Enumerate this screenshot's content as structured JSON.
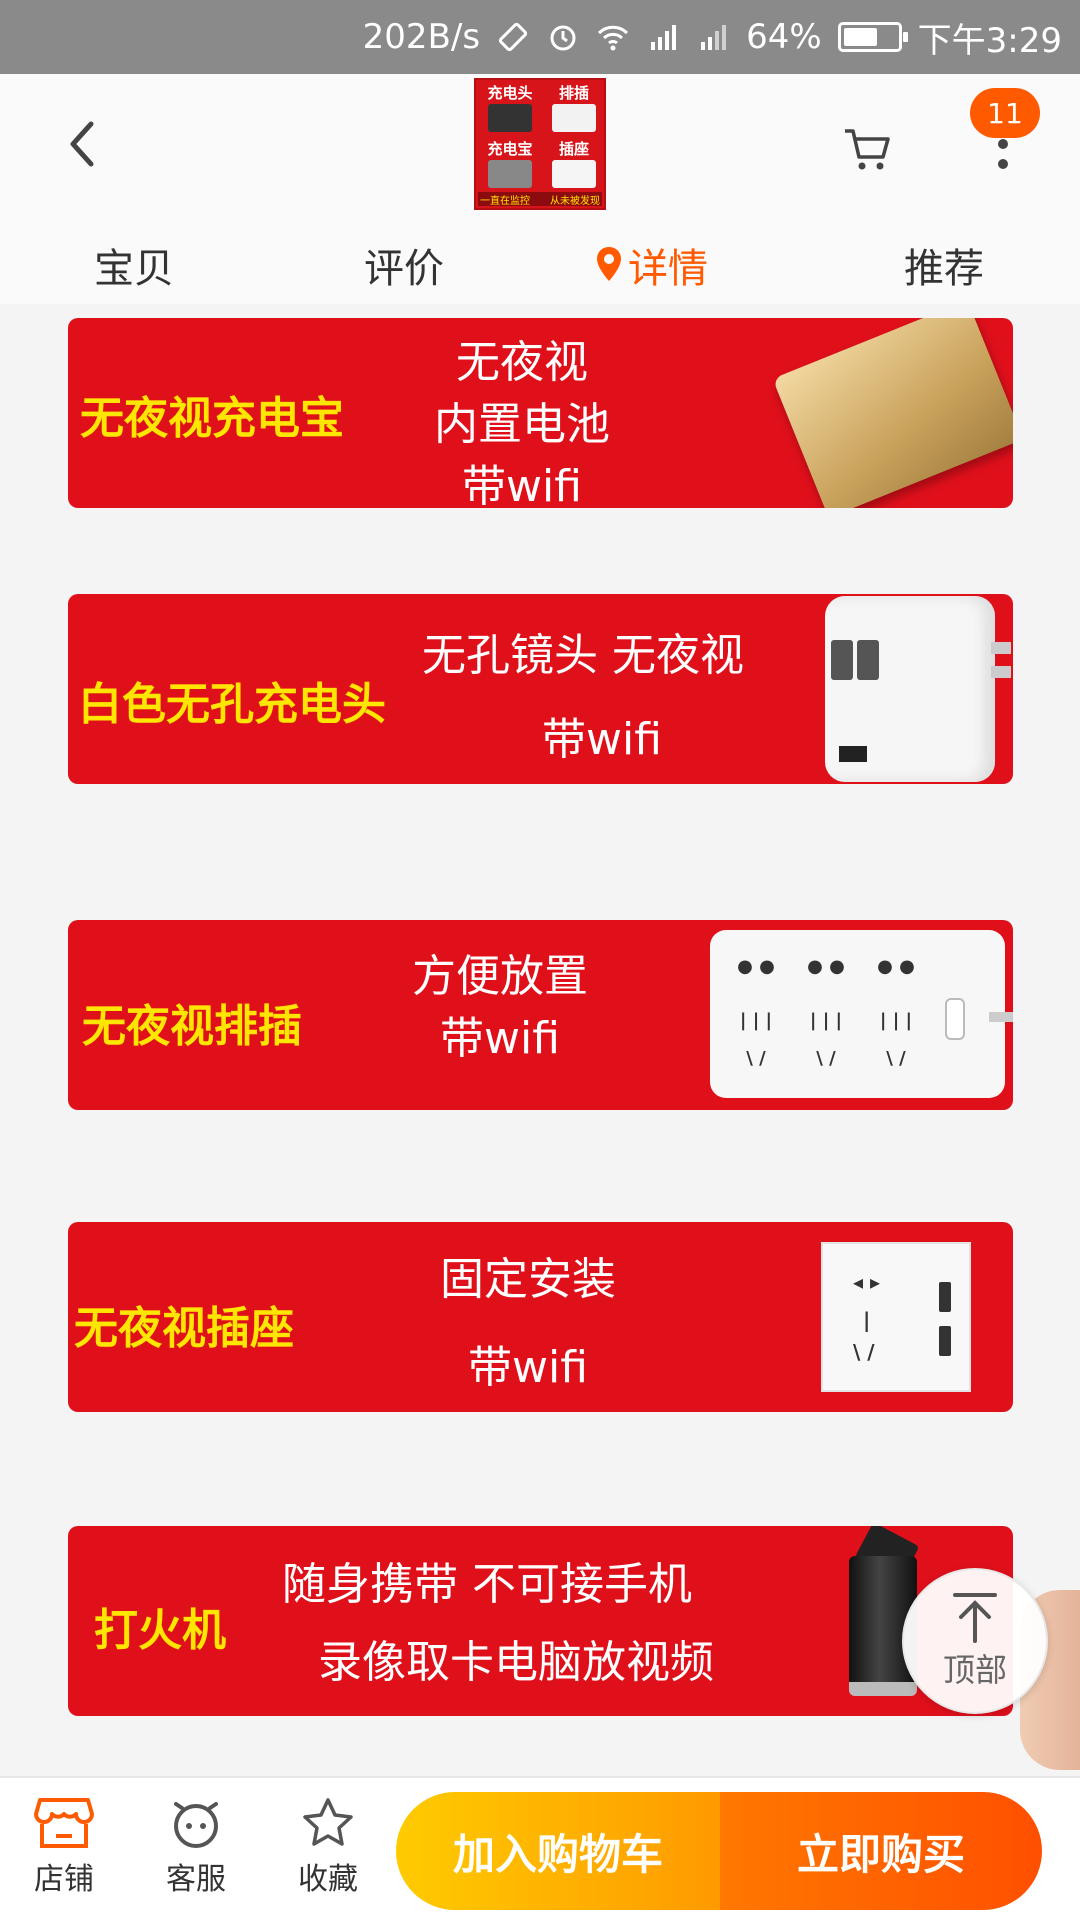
{
  "status_bar": {
    "net_speed": "202B/s",
    "battery": "64%",
    "battery_level": 0.64,
    "time": "下午3:29",
    "icons": [
      "rotate-icon",
      "alarm-icon",
      "wifi-icon",
      "signal-icon",
      "signal-icon",
      "battery-icon"
    ]
  },
  "header": {
    "badge_count": "11",
    "thumbnail": {
      "cells": [
        "充电头",
        "排插",
        "充电宝",
        "插座"
      ],
      "footer_left": "一直在监控",
      "footer_right": "从未被发现"
    },
    "icons": {
      "back": "chevron-left-icon",
      "cart": "cart-icon",
      "more": "more-vertical-icon"
    }
  },
  "tabs": [
    {
      "label": "宝贝",
      "active": false
    },
    {
      "label": "评价",
      "active": false
    },
    {
      "label": "详情",
      "active": true,
      "icon": "location-pin-icon"
    },
    {
      "label": "推荐",
      "active": false
    }
  ],
  "banners": [
    {
      "title": "无夜视充电宝",
      "lines": [
        "无夜视",
        "内置电池",
        "带wifi"
      ],
      "product": "power-bank"
    },
    {
      "title": "白色无孔充电头",
      "lines": [
        "无孔镜头  无夜视",
        "带wifi"
      ],
      "product": "usb-charger"
    },
    {
      "title": "无夜视排插",
      "lines": [
        "方便放置",
        "带wifi"
      ],
      "product": "power-strip"
    },
    {
      "title": "无夜视插座",
      "lines": [
        "固定安装",
        "带wifi"
      ],
      "product": "wall-outlet"
    },
    {
      "title": "打火机",
      "lines": [
        "随身携带    不可接手机",
        "录像取卡电脑放视频"
      ],
      "product": "lighter"
    }
  ],
  "back_to_top": {
    "label": "顶部",
    "icon": "arrow-up-icon"
  },
  "bottom_bar": {
    "items": [
      {
        "label": "店铺",
        "icon": "store-icon"
      },
      {
        "label": "客服",
        "icon": "chat-icon"
      },
      {
        "label": "收藏",
        "icon": "star-icon"
      }
    ],
    "add_to_cart": "加入购物车",
    "buy_now": "立即购买"
  },
  "colors": {
    "accent": "#ff5a00",
    "banner_red": "#e0101b",
    "banner_title": "#ffe600",
    "cta_yellow": "#ffb300",
    "cta_orange": "#ff5f00",
    "status_bar": "#8a8a8a"
  }
}
